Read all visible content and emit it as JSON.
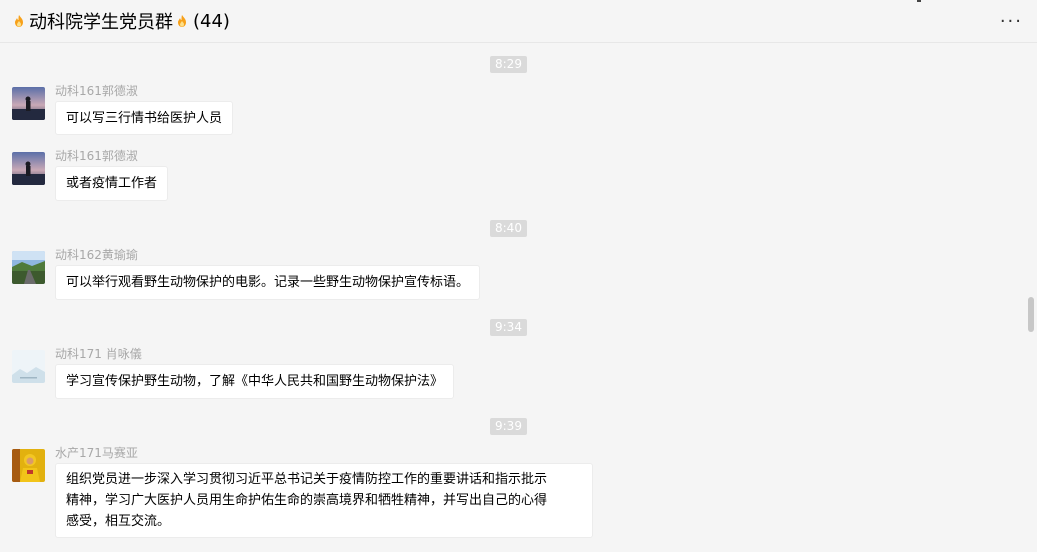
{
  "header": {
    "title": "动科院学生党员群",
    "member_count": "(44)",
    "more_icon": "more-dots-icon",
    "title_icons": [
      "fire-icon",
      "fire-icon"
    ]
  },
  "messages": [
    {
      "type": "time",
      "text": "8:29"
    },
    {
      "type": "msg",
      "sender": "动科161郭德淑",
      "text": "可以写三行情书给医护人员",
      "avatar": "sunset-silhouette-avatar"
    },
    {
      "type": "msg",
      "sender": "动科161郭德淑",
      "text": "或者疫情工作者",
      "avatar": "sunset-silhouette-avatar"
    },
    {
      "type": "time",
      "text": "8:40"
    },
    {
      "type": "msg",
      "sender": "动科162黄瑜瑜",
      "text": "可以举行观看野生动物保护的电影。记录一些野生动物保护宣传标语。",
      "avatar": "landscape-road-avatar"
    },
    {
      "type": "time",
      "text": "9:34"
    },
    {
      "type": "msg",
      "sender": "动科171 肖咏儀",
      "text": "学习宣传保护野生动物，了解《中华人民共和国野生动物保护法》",
      "avatar": "pale-landscape-avatar"
    },
    {
      "type": "time",
      "text": "9:39"
    },
    {
      "type": "msg",
      "sender": "水产171马赛亚",
      "text_lines": [
        "组织党员进一步深入学习贯彻习近平总书记关于疫情防控工作的重要讲话和指示批示",
        "精神，学习广大医护人员用生命护佑生命的崇高境界和牺牲精神，并写出自己的心得",
        "感受，相互交流。"
      ],
      "avatar": "yellow-figure-avatar"
    }
  ],
  "colors": {
    "background": "#f5f5f5",
    "bubble": "#ffffff",
    "time_badge": "#dadada",
    "sender_text": "#a8a8a8"
  }
}
